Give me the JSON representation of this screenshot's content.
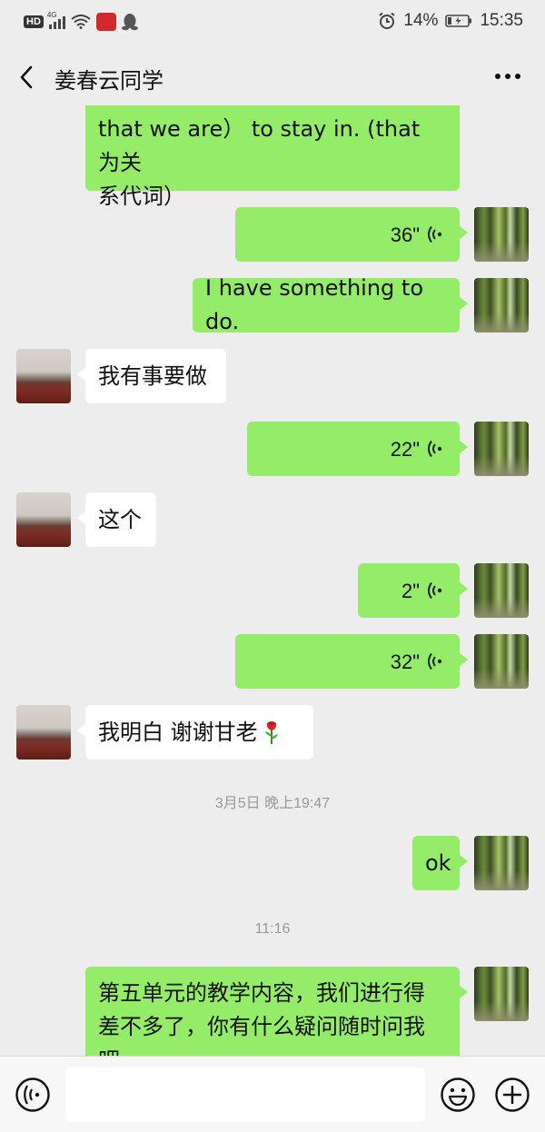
{
  "status_bar": {
    "hd_badge": "HD",
    "network": "4G",
    "battery_percent": "14%",
    "time": "15:35"
  },
  "header": {
    "title": "姜春云同学",
    "back_icon": "chevron-left-icon",
    "more_icon": "more-dots-icon"
  },
  "messages": [
    {
      "sender": "me",
      "type": "text",
      "lines": [
        "that we are）  to stay in. (that 为关",
        "系代词）"
      ]
    },
    {
      "sender": "me",
      "type": "voice",
      "duration": "36\""
    },
    {
      "sender": "me",
      "type": "text",
      "text": "I have something to do."
    },
    {
      "sender": "other",
      "type": "text",
      "text": "我有事要做"
    },
    {
      "sender": "me",
      "type": "voice",
      "duration": "22\""
    },
    {
      "sender": "other",
      "type": "text",
      "text": "这个"
    },
    {
      "sender": "me",
      "type": "voice",
      "duration": "2\""
    },
    {
      "sender": "me",
      "type": "voice",
      "duration": "32\""
    },
    {
      "sender": "other",
      "type": "text",
      "text": "我明白  谢谢甘老",
      "emoji": "rose-emoji"
    },
    {
      "type": "timestamp",
      "text": "3月5日 晚上19:47"
    },
    {
      "sender": "me",
      "type": "text",
      "text": "ok"
    },
    {
      "type": "timestamp",
      "text": "11:16"
    },
    {
      "sender": "me",
      "type": "text",
      "lines": [
        "第五单元的教学内容，我们进行得",
        "差不多了，你有什么疑问随时问我",
        "吧。"
      ]
    }
  ],
  "input_bar": {
    "voice_icon": "voice-mode-icon",
    "input_value": "",
    "emoji_icon": "emoji-icon",
    "plus_icon": "plus-icon"
  },
  "colors": {
    "my_bubble": "#95ec69",
    "other_bubble": "#ffffff",
    "background": "#ededed"
  }
}
